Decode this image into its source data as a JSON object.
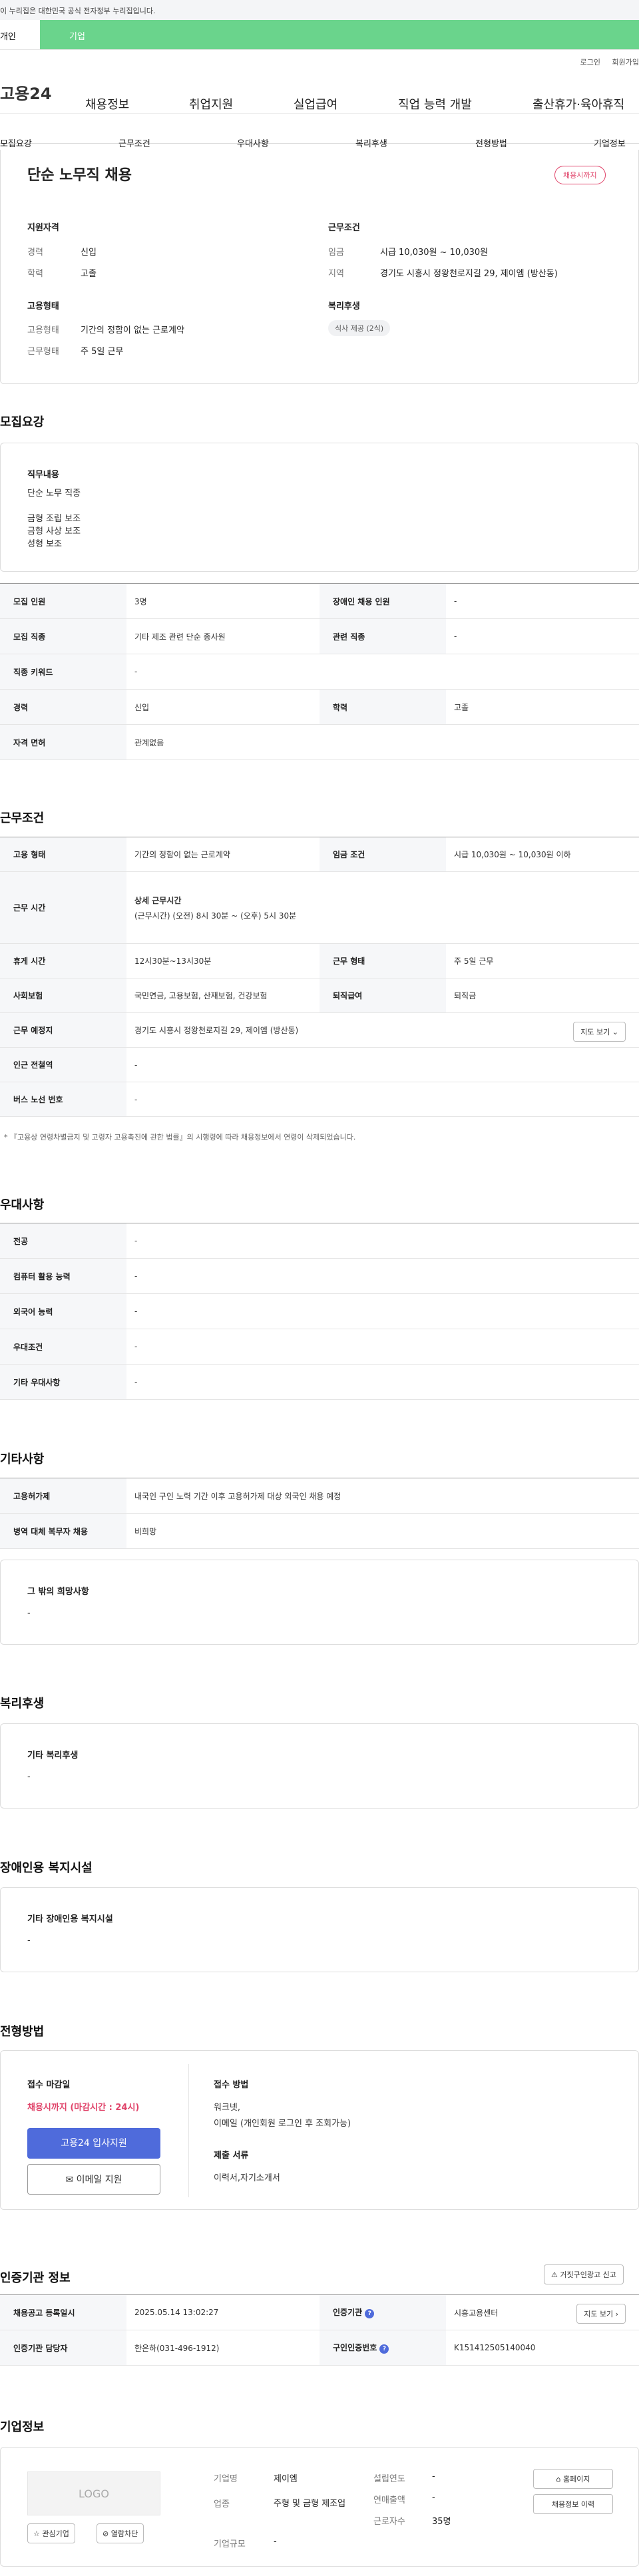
{
  "gov_banner": "이 누리집은 대한민국 공식 전자정부 누리집입니다.",
  "tabs": {
    "personal": "개인",
    "company": "기업"
  },
  "util": {
    "login": "로그인",
    "signup": "회원가입"
  },
  "header": {
    "logo": "고용24",
    "menu": [
      "채용정보",
      "취업지원",
      "실업급여",
      "직업 능력 개발",
      "출산휴가·육아휴직"
    ]
  },
  "subnav": [
    "모집요강",
    "근무조건",
    "우대사항",
    "복리후생",
    "전형방법",
    "기업정보"
  ],
  "summary": {
    "title": "단순 노무직 채용",
    "deadline_badge": "채용시까지",
    "qual_title": "지원자격",
    "career_label": "경력",
    "career_value": "신입",
    "edu_label": "학력",
    "edu_value": "고졸",
    "cond_title": "근무조건",
    "wage_label": "임금",
    "wage_value": "시급 10,030원 ~ 10,030원",
    "region_label": "지역",
    "region_value": "경기도 시흥시 정왕천로지길 29, 제이엠 (방산동)",
    "emp_title": "고용형태",
    "emptype_label": "고용형태",
    "emptype_value": "기간의 정함이 없는 근로계약",
    "worktype_label": "근무형태",
    "worktype_value": "주 5일 근무",
    "welfare_title": "복리후생",
    "welfare_tag": "식사 제공 (2식)"
  },
  "recruit": {
    "title": "모집요강",
    "job_title": "직무내용",
    "job_lines": [
      "단순 노무 직종",
      "",
      "금형 조립 보조",
      "금형 사상 보조",
      "성형 보조"
    ],
    "rows": [
      {
        "k1": "모집 인원",
        "v1": "3명",
        "k2": "장애인 채용 인원",
        "v2": "-"
      },
      {
        "k1": "모집 직종",
        "v1": "기타 제조 관련 단순 종사원",
        "k2": "관련 직종",
        "v2": "-"
      },
      {
        "k1": "직종 키워드",
        "v1": "-"
      },
      {
        "k1": "경력",
        "v1": "신입",
        "k2": "학력",
        "v2": "고졸"
      },
      {
        "k1": "자격 면허",
        "v1": "관계없음"
      }
    ]
  },
  "work": {
    "title": "근무조건",
    "emp_k": "고용 형태",
    "emp_v": "기간의 정함이 없는 근로계약",
    "wage_k": "임금 조건",
    "wage_v": "시급 10,030원 ~ 10,030원 이하",
    "time_k": "근무 시간",
    "time_sub": "상세 근무시간",
    "time_v": "(근무시간) (오전) 8시 30분 ~ (오후) 5시 30분",
    "rest_k": "휴게 시간",
    "rest_v": "12시30분~13시30분",
    "form_k": "근무 형태",
    "form_v": "주 5일 근무",
    "ins_k": "사회보험",
    "ins_v": "국민연금, 고용보험, 산재보험, 건강보험",
    "sev_k": "퇴직급여",
    "sev_v": "퇴직금",
    "place_k": "근무 예정지",
    "place_v": "경기도 시흥시 정왕천로지길 29, 제이엠 (방산동)",
    "map_btn": "지도 보기",
    "subway_k": "인근 전철역",
    "subway_v": "-",
    "bus_k": "버스 노선 번호",
    "bus_v": "-",
    "note": "* 『고용상 연령차별금지 및 고령자 고용촉진에 관한 법률』의 시행령에 따라 채용정보에서 연령이 삭제되었습니다."
  },
  "pref": {
    "title": "우대사항",
    "rows": [
      {
        "k": "전공",
        "v": "-"
      },
      {
        "k": "컴퓨터 활용 능력",
        "v": "-"
      },
      {
        "k": "외국어 능력",
        "v": "-"
      },
      {
        "k": "우대조건",
        "v": "-"
      },
      {
        "k": "기타 우대사항",
        "v": "-"
      }
    ]
  },
  "etc": {
    "title": "기타사항",
    "rows": [
      {
        "k": "고용허가제",
        "v": "내국인 구인 노력 기간 이후 고용허가제 대상 외국인 채용 예정"
      },
      {
        "k": "병역 대체 복무자 채용",
        "v": "비희망"
      }
    ],
    "other_title": "그 밖의 희망사항",
    "other_v": "-"
  },
  "welfare": {
    "title": "복리후생",
    "box_title": "기타 복리후생",
    "box_v": "-"
  },
  "disab": {
    "title": "장애인용 복지시설",
    "box_title": "기타 장애인용 복지시설",
    "box_v": "-"
  },
  "select": {
    "title": "전형방법",
    "deadline_title": "접수 마감일",
    "deadline_v": "채용시까지 (마감시간 : 24시)",
    "apply_btn": "고용24 입사지원",
    "email_btn": "이메일 지원",
    "method_title": "접수 방법",
    "method_v": "워크넷,",
    "method_v2": "이메일 (개인회원 로그인 후 조회가능)",
    "docs_title": "제출 서류",
    "docs_v": "이력서,자기소개서"
  },
  "cert": {
    "title": "인증기관 정보",
    "report_btn": "거짓구인광고 신고",
    "reg_k": "채용공고 등록일시",
    "reg_v": "2025.05.14 13:02:27",
    "org_k": "인증기관",
    "org_v": "시흥고용센터",
    "map_btn": "지도 보기",
    "mgr_k": "인증기관 담당자",
    "mgr_v": "한은하(031-496-1912)",
    "no_k": "구인인증번호",
    "no_v": "K151412505140040"
  },
  "company": {
    "title": "기업정보",
    "logo": "LOGO",
    "fav_btn": "관심기업",
    "block_btn": "열람차단",
    "name_k": "기업명",
    "name_v": "제이엠",
    "ind_k": "업종",
    "ind_v": "주형 및 금형 제조업",
    "size_k": "기업규모",
    "size_v": "-",
    "est_k": "설립연도",
    "est_v": "-",
    "sales_k": "연매출액",
    "sales_v": "-",
    "emp_k": "근로자수",
    "emp_v": "35명",
    "home_btn": "홈페이지",
    "history_btn": "채용정보 이력"
  }
}
